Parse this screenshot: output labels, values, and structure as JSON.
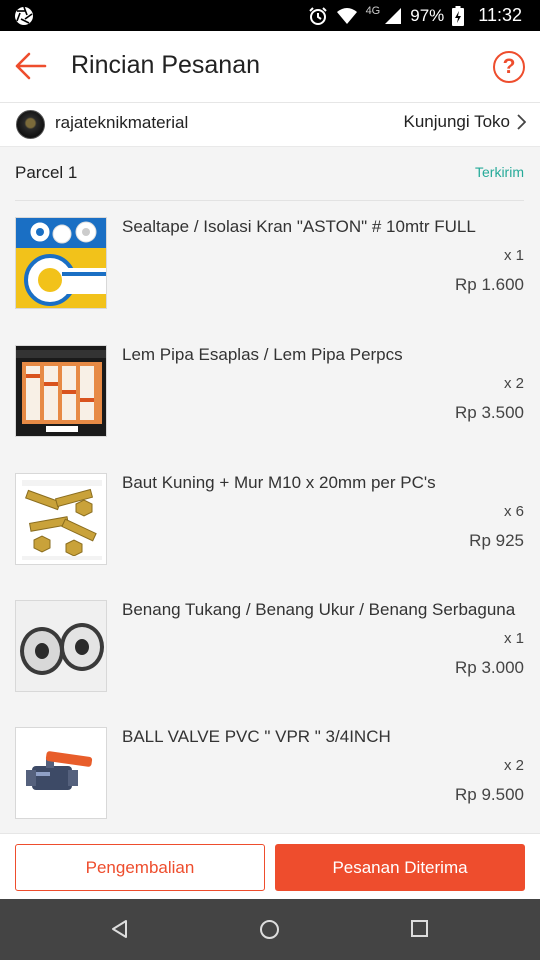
{
  "status_bar": {
    "network": "4G",
    "battery": "97%",
    "time": "11:32",
    "icons": [
      "aperture-icon",
      "alarm-icon",
      "wifi-icon",
      "signal-icon",
      "battery-icon"
    ]
  },
  "header": {
    "title": "Rincian Pesanan",
    "back_icon": "arrow-left-icon",
    "help_icon": "question-circle-icon",
    "help_label": "?"
  },
  "shop": {
    "name": "rajateknikmaterial",
    "visit_label": "Kunjungi Toko"
  },
  "parcel": {
    "title": "Parcel 1",
    "status": "Terkirim"
  },
  "items": [
    {
      "name": "Sealtape / Isolasi Kran \"ASTON\" # 10mtr FULL",
      "qty": "x 1",
      "price": "Rp 1.600"
    },
    {
      "name": "Lem Pipa Esaplas / Lem Pipa Perpcs",
      "qty": "x 2",
      "price": "Rp 3.500"
    },
    {
      "name": "Baut Kuning + Mur M10 x 20mm per PC's",
      "qty": "x 6",
      "price": "Rp 925"
    },
    {
      "name": "Benang Tukang / Benang Ukur / Benang Serbaguna",
      "qty": "x 1",
      "price": "Rp 3.000"
    },
    {
      "name": "BALL VALVE PVC \" VPR \" 3/4INCH",
      "qty": "x 2",
      "price": "Rp 9.500"
    }
  ],
  "actions": {
    "return_label": "Pengembalian",
    "received_label": "Pesanan Diterima"
  },
  "colors": {
    "accent": "#ee4d2d",
    "status_green": "#26aa99"
  }
}
